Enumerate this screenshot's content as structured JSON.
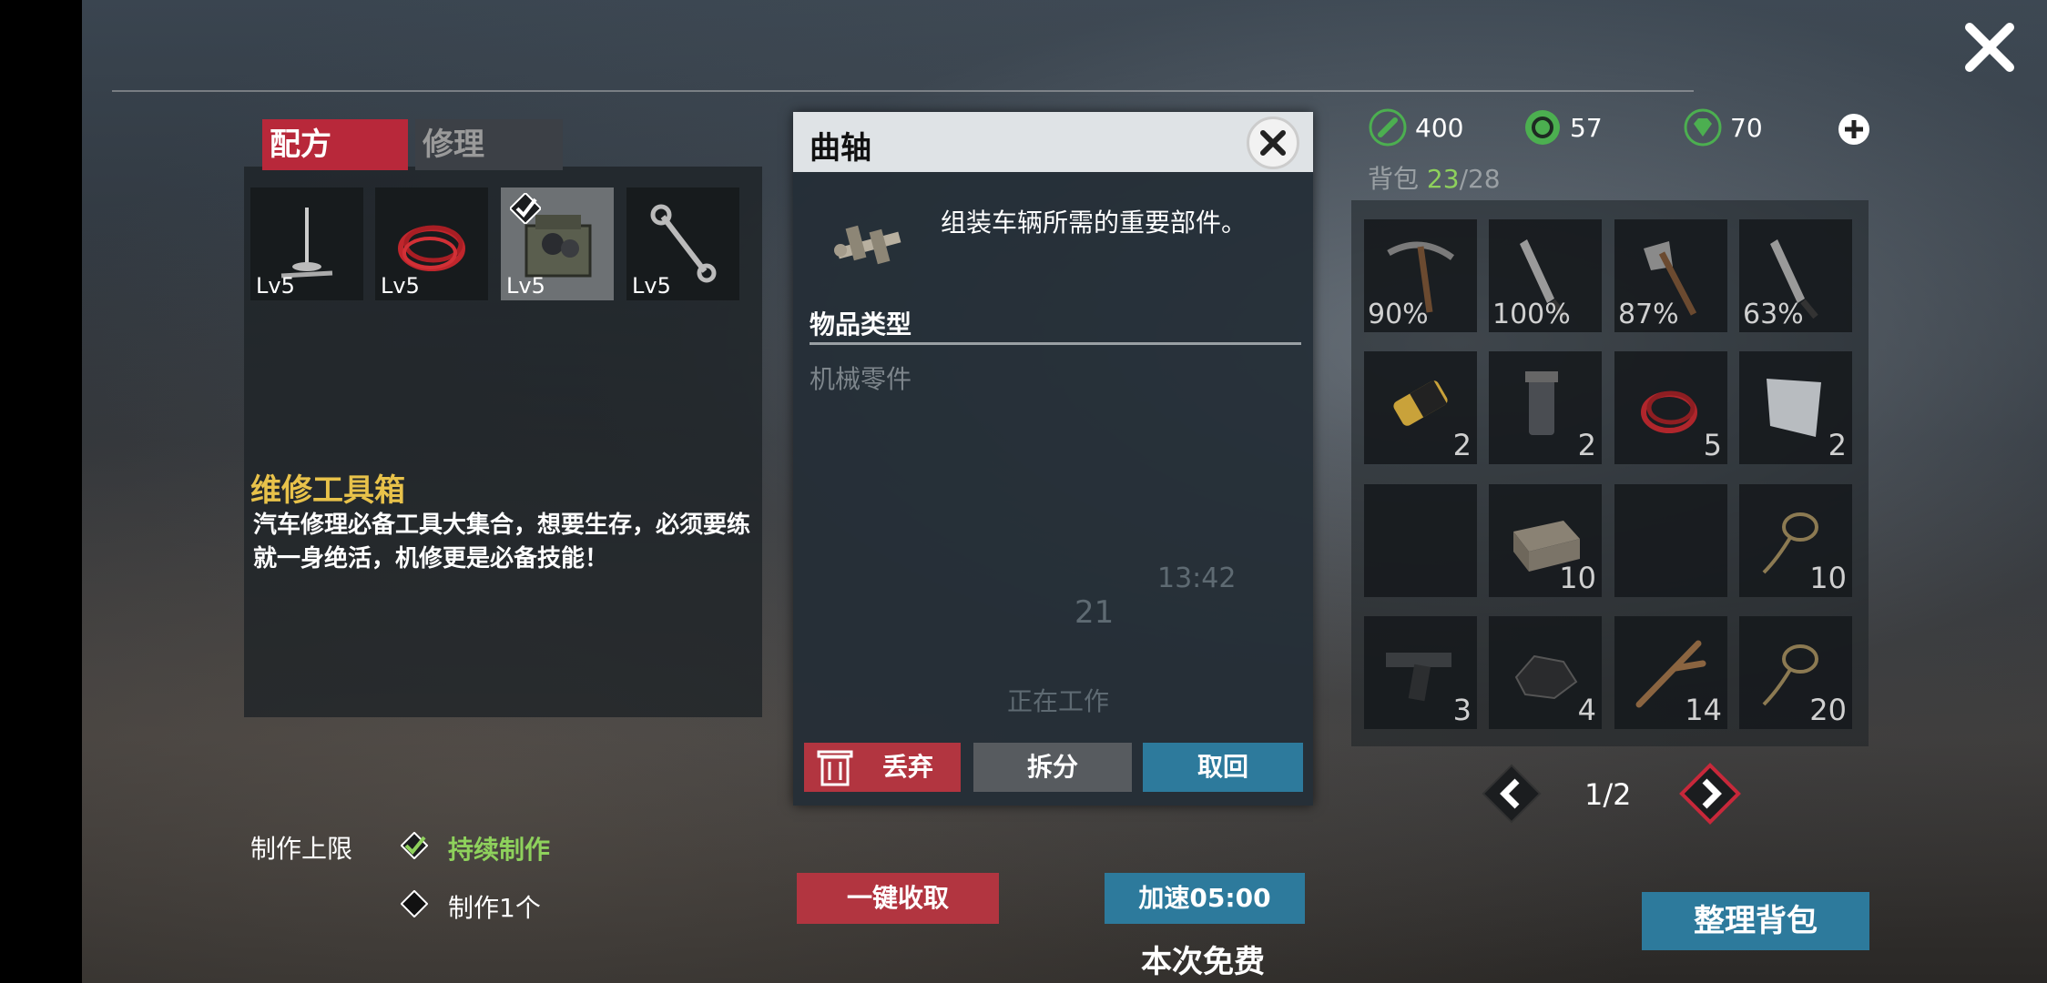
{
  "tabs": {
    "recipe": "配方",
    "repair": "修理"
  },
  "recipes": [
    {
      "icon": "nail-icon",
      "level": "Lv5"
    },
    {
      "icon": "wire-coil-icon",
      "level": "Lv5"
    },
    {
      "icon": "toolbox-icon",
      "level": "Lv5",
      "selected": true
    },
    {
      "icon": "wrench-icon",
      "level": "Lv5"
    }
  ],
  "selected_recipe": {
    "title": "维修工具箱",
    "description": "汽车修理必备工具大集合，想要生存，必须要练就一身绝活，机修更是必备技能！"
  },
  "craft_limit": {
    "label": "制作上限",
    "continuous": "持续制作",
    "one": "制作1个"
  },
  "modal": {
    "title": "曲轴",
    "description": "组装车辆所需的重要部件。",
    "type_label": "物品类型",
    "type_value": "机械零件",
    "background_status": "正在工作",
    "background_count": "21",
    "background_time": "13:42",
    "buttons": {
      "discard": "丢弃",
      "split": "拆分",
      "retrieve": "取回"
    }
  },
  "actions": {
    "collect_all": "一键收取",
    "speed_up": "加速05:00",
    "free_note": "本次免费",
    "sort_bag": "整理背包"
  },
  "resources": [
    {
      "icon": "wrench-coin-icon",
      "value": "400",
      "color": "#4caf50"
    },
    {
      "icon": "gear-coin-icon",
      "value": "57",
      "color": "#4caf50"
    },
    {
      "icon": "diamond-icon",
      "value": "70",
      "color": "#4caf50"
    }
  ],
  "bag": {
    "label": "背包",
    "current": "23",
    "max": "/28"
  },
  "inventory": [
    {
      "icon": "pickaxe-icon",
      "durability": "90%"
    },
    {
      "icon": "machete-icon",
      "durability": "100%"
    },
    {
      "icon": "axe-icon",
      "durability": "87%"
    },
    {
      "icon": "machete-icon",
      "durability": "63%"
    },
    {
      "icon": "battery-icon",
      "qty": "2"
    },
    {
      "icon": "flashlight-icon",
      "qty": "2"
    },
    {
      "icon": "wire-coil-icon",
      "qty": "5"
    },
    {
      "icon": "metal-sheet-icon",
      "qty": "2"
    },
    {
      "icon": "empty",
      "qty": ""
    },
    {
      "icon": "brick-icon",
      "qty": "10"
    },
    {
      "icon": "empty",
      "qty": ""
    },
    {
      "icon": "rope-icon",
      "qty": "10"
    },
    {
      "icon": "pistol-icon",
      "qty": "3"
    },
    {
      "icon": "coal-icon",
      "qty": "4"
    },
    {
      "icon": "branch-icon",
      "qty": "14"
    },
    {
      "icon": "rope-icon",
      "qty": "20"
    }
  ],
  "pagination": {
    "indicator": "1/2"
  }
}
